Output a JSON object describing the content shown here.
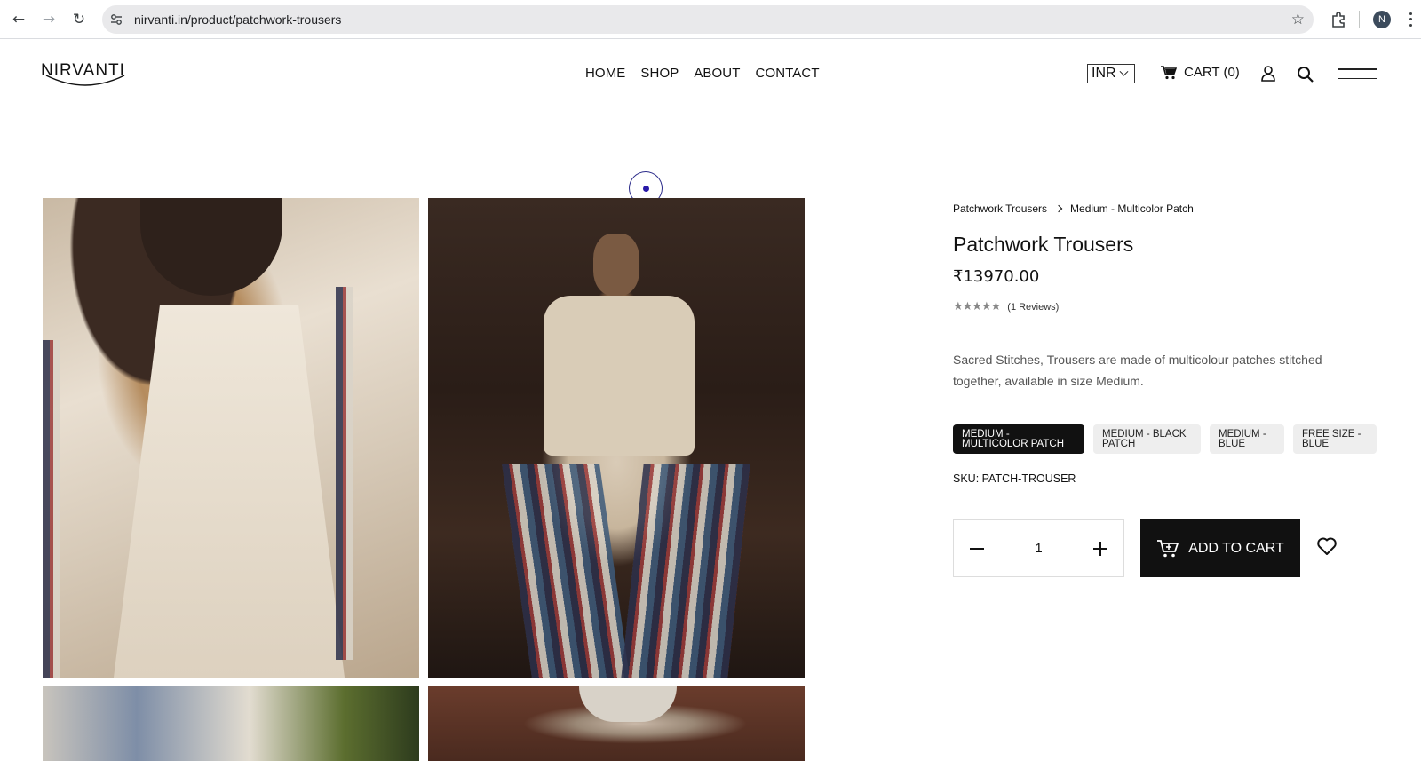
{
  "browser": {
    "url": "nirvanti.in/product/patchwork-trousers",
    "profile_initial": "N"
  },
  "site": {
    "logo_text": "NIRVANTI",
    "nav": [
      "HOME",
      "SHOP",
      "ABOUT",
      "CONTACT"
    ],
    "currency": "INR",
    "cart_label": "CART (0)"
  },
  "product": {
    "breadcrumb": [
      "Patchwork Trousers",
      "Medium - Multicolor Patch"
    ],
    "title": "Patchwork Trousers",
    "price": "₹13970.00",
    "rating_stars": 5,
    "reviews_label": "(1 Reviews)",
    "description": "Sacred Stitches, Trousers are made of multicolour patches stitched together, available in size Medium.",
    "variants": [
      {
        "label": "MEDIUM - MULTICOLOR PATCH",
        "selected": true
      },
      {
        "label": "MEDIUM - BLACK PATCH",
        "selected": false
      },
      {
        "label": "MEDIUM - BLUE",
        "selected": false
      },
      {
        "label": "FREE SIZE - BLUE",
        "selected": false
      }
    ],
    "sku": "SKU: PATCH-TROUSER",
    "quantity": "1",
    "add_to_cart_label": "ADD TO CART"
  },
  "colors": {
    "primary": "#111111",
    "variant_bg": "#eeeeee"
  }
}
